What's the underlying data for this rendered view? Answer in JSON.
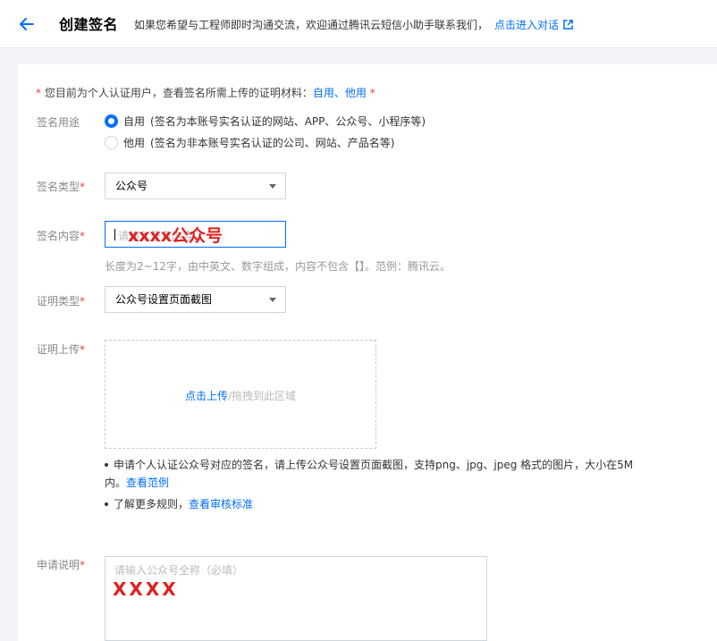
{
  "header": {
    "title": "创建签名",
    "note": "如果您希望与工程师即时沟通交流，欢迎通过腾讯云短信小助手联系我们，",
    "chat_link": "点击进入对话"
  },
  "notice": {
    "prefix": "* ",
    "text": "您目前为个人认证用户，查看签名所需上传的证明材料：",
    "link_self": "自用",
    "separator": "、",
    "link_other": "他用",
    "suffix": " *"
  },
  "form": {
    "usage": {
      "label": "签名用途",
      "options": [
        {
          "label": "自用",
          "desc": "(签名为本账号实名认证的网站、APP、公众号、小程序等)",
          "checked": true
        },
        {
          "label": "他用",
          "desc": "(签名为非本账号实名认证的公司、网站、产品名等)",
          "checked": false
        }
      ]
    },
    "type": {
      "label": "签名类型",
      "star": "*",
      "value": "公众号"
    },
    "content": {
      "label": "签名内容",
      "star": "*",
      "placeholder": "请输入签名内容",
      "overlay": "xxxx公众号",
      "hint": "长度为2~12字，由中英文、数字组成，内容不包含【】。范例：腾讯云。"
    },
    "proof_type": {
      "label": "证明类型",
      "star": "*",
      "value": "公众号设置页面截图"
    },
    "upload": {
      "label": "证明上传",
      "star": "*",
      "link": "点击上传",
      "drag": "/拖拽到此区域",
      "bullet1_line1": "申请个人认证公众号对应的签名，请上传公众号设置页面截图，支持png、jpg、jpeg 格式的图片，大小在5M",
      "bullet1_line2": "内。",
      "bullet1_link": "查看范例",
      "bullet2": "了解更多规则，",
      "bullet2_link": "查看审核标准"
    },
    "description": {
      "label": "申请说明",
      "star": "*",
      "placeholder": "请输入公众号全称（必填）",
      "overlay": "XXXX"
    }
  },
  "colors": {
    "accent": "#006eff",
    "required": "#e54545",
    "annotation": "#e02020"
  }
}
